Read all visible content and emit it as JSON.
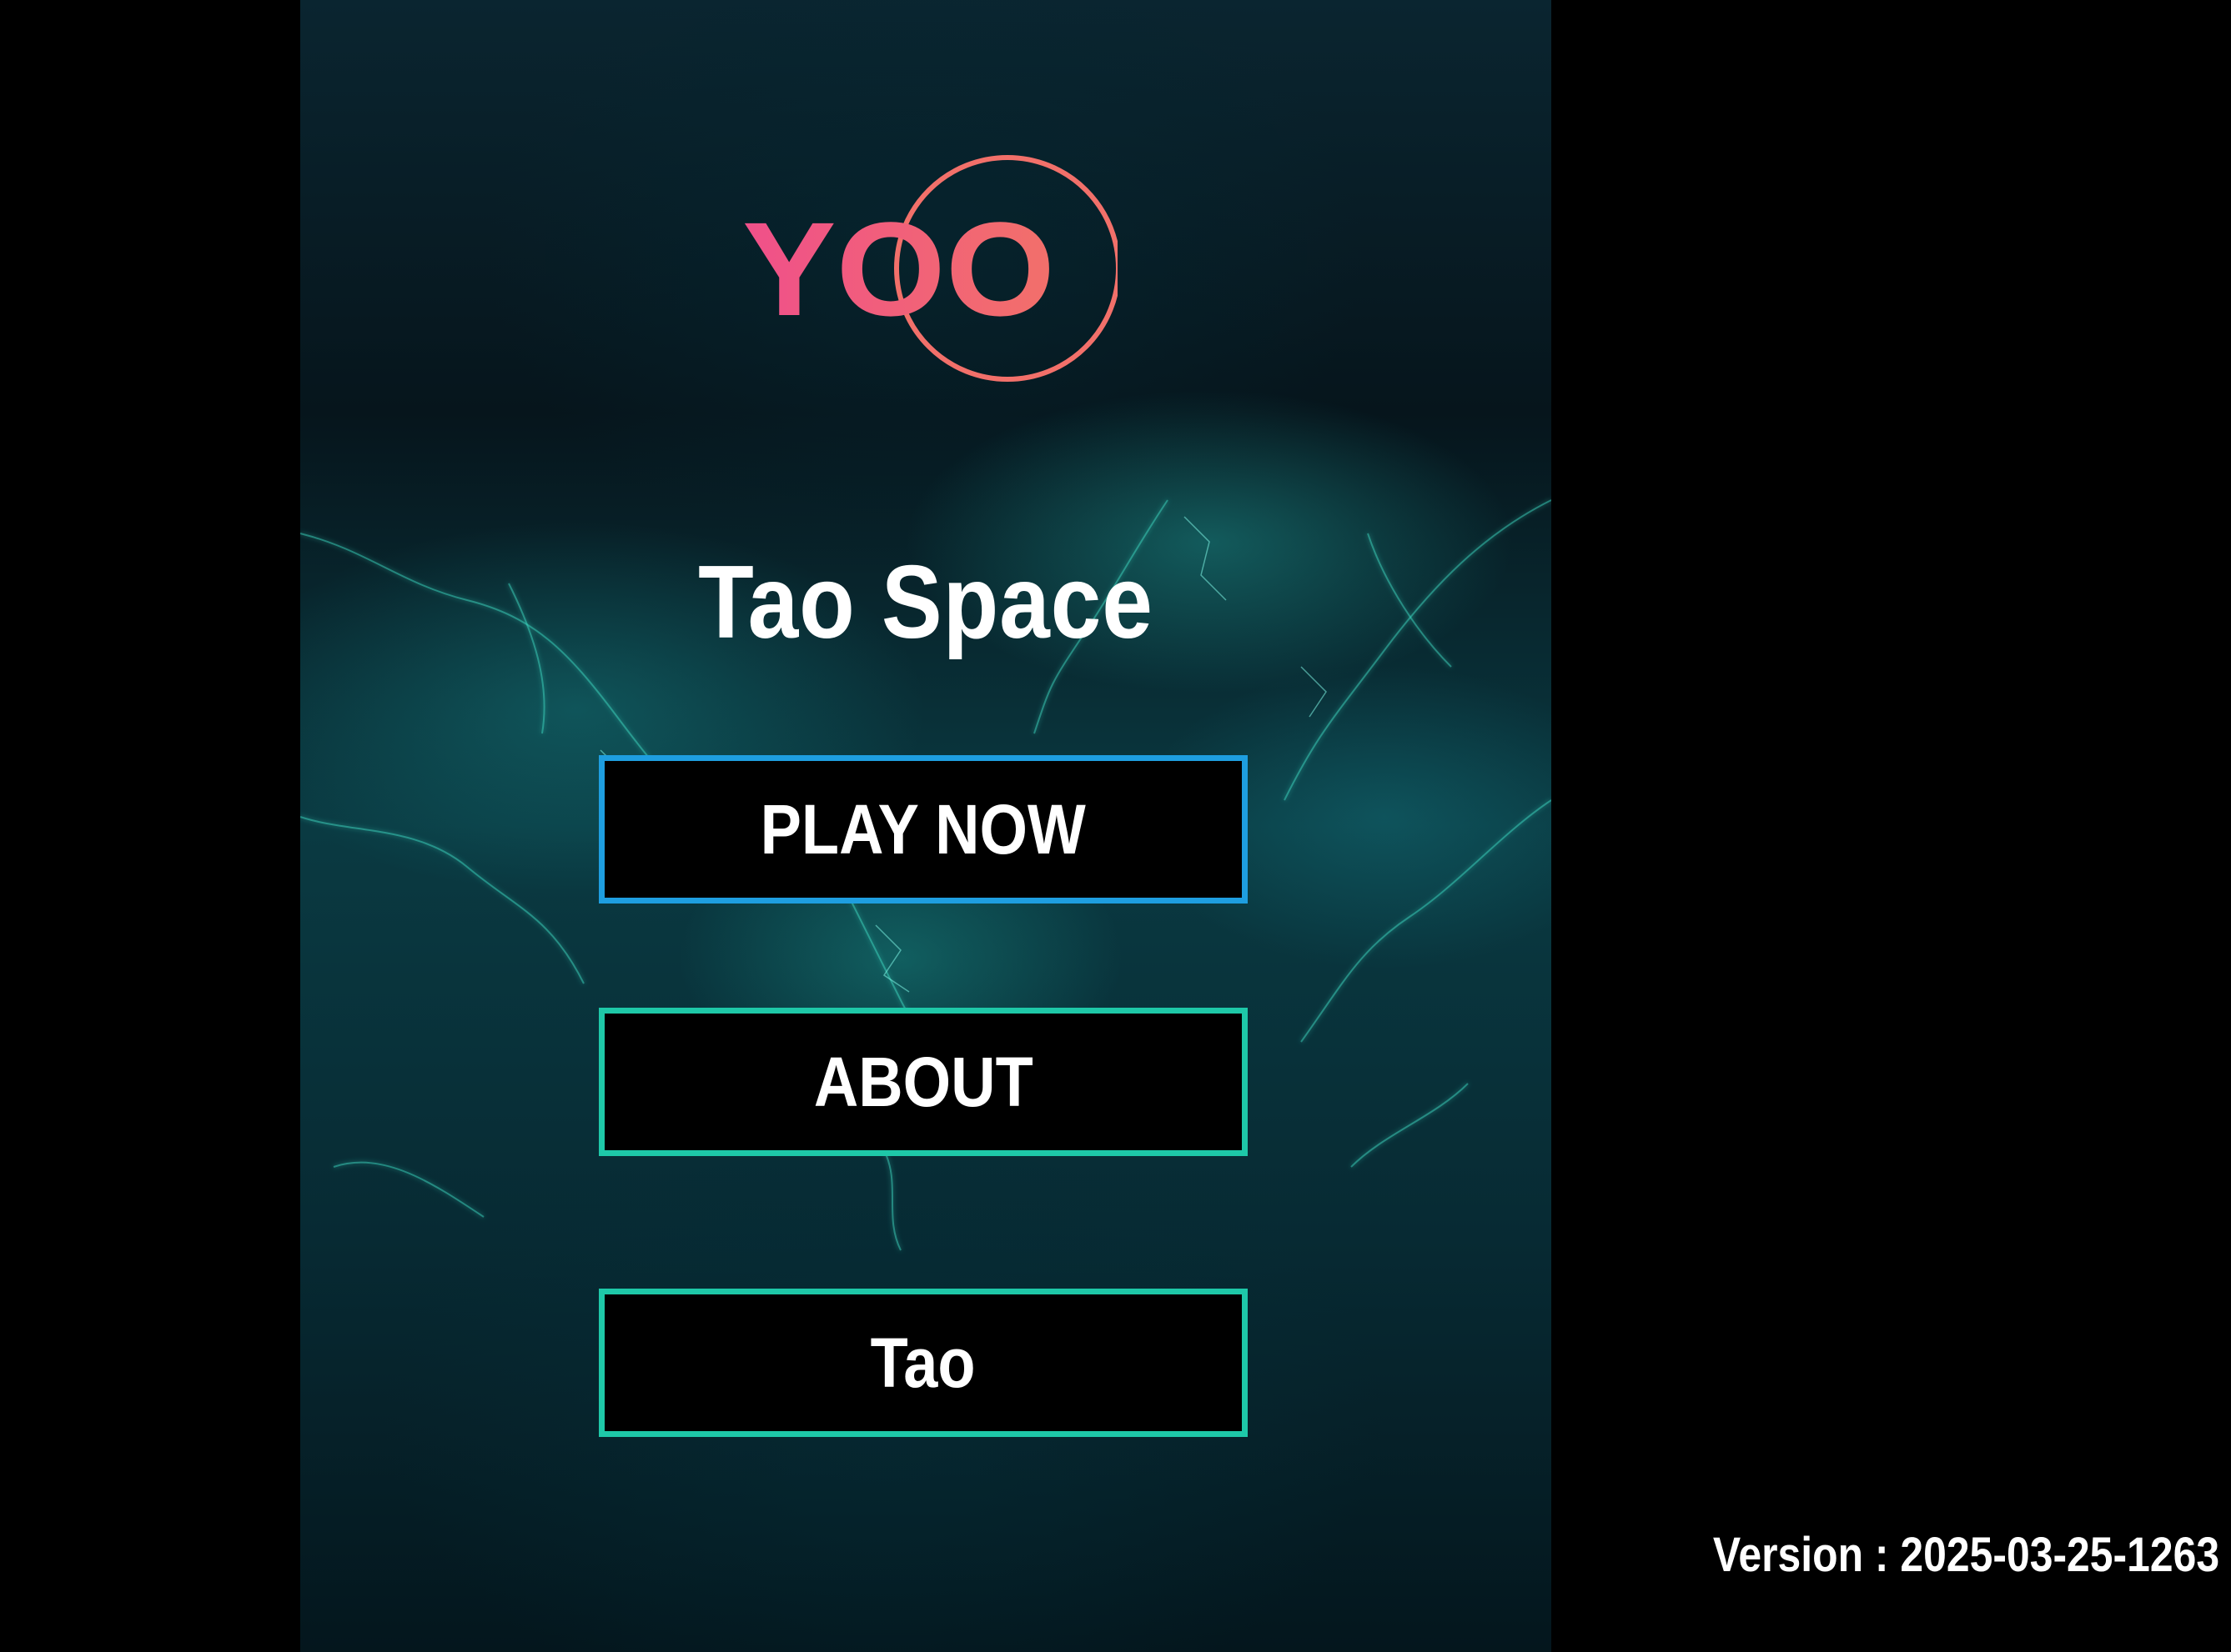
{
  "background_color": "#000000",
  "logo": {
    "text": "YOO",
    "gradient_start": "#f0508a",
    "gradient_end": "#f2706a"
  },
  "title": "Tao Space",
  "menu": {
    "play_label": "PLAY NOW",
    "about_label": "ABOUT",
    "tao_label": "Tao",
    "play_border_color": "#1e9ee0",
    "other_border_color": "#1ec8a8"
  },
  "version": "Version : 2025-03-25-1263"
}
